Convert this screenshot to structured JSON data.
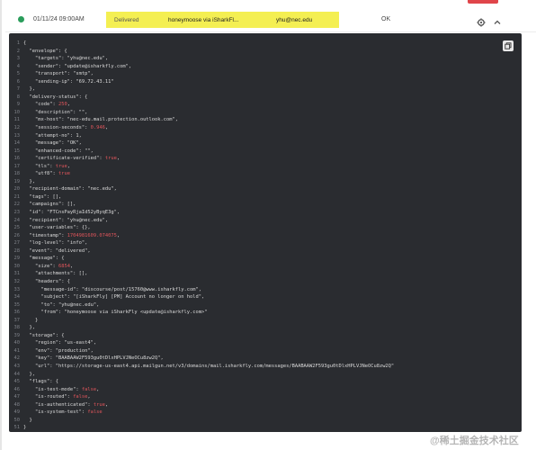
{
  "row": {
    "timestamp": "01/11/24 09:00AM",
    "event": "Delivered",
    "subject": "honeymoose via iSharkFl...",
    "recipient": "yhu@nec.edu",
    "status": "OK",
    "gear_icon": "gear-icon",
    "chevron_icon": "chevron-up-icon"
  },
  "code_lines": [
    {
      "n": "1",
      "t": "{"
    },
    {
      "n": "2",
      "t": "  \"envelope\": {"
    },
    {
      "n": "3",
      "t": "    \"targets\": \"yhu@nec.edu\","
    },
    {
      "n": "4",
      "t": "    \"sender\": \"update@isharkfly.com\","
    },
    {
      "n": "5",
      "t": "    \"transport\": \"smtp\","
    },
    {
      "n": "6",
      "t": "    \"sending-ip\": \"69.72.43.11\""
    },
    {
      "n": "7",
      "t": "  },"
    },
    {
      "n": "8",
      "t": "  \"delivery-status\": {"
    },
    {
      "n": "9",
      "t": "    \"code\": ",
      "v": "250",
      "vt": "num",
      "s": ","
    },
    {
      "n": "10",
      "t": "    \"description\": \"\","
    },
    {
      "n": "11",
      "t": "    \"mx-host\": \"nec-edu.mail.protection.outlook.com\","
    },
    {
      "n": "12",
      "t": "    \"session-seconds\": ",
      "v": "0.946",
      "vt": "num",
      "s": ","
    },
    {
      "n": "13",
      "t": "    \"attempt-no\": 1,"
    },
    {
      "n": "14",
      "t": "    \"message\": \"OK\","
    },
    {
      "n": "15",
      "t": "    \"enhanced-code\": \"\","
    },
    {
      "n": "16",
      "t": "    \"certificate-verified\": ",
      "v": "true",
      "vt": "bool",
      "s": ","
    },
    {
      "n": "17",
      "t": "    \"tls\": ",
      "v": "true",
      "vt": "bool",
      "s": ","
    },
    {
      "n": "18",
      "t": "    \"utf8\": ",
      "v": "true",
      "vt": "bool",
      "s": ""
    },
    {
      "n": "19",
      "t": "  },"
    },
    {
      "n": "20",
      "t": "  \"recipient-domain\": \"nec.edu\","
    },
    {
      "n": "21",
      "t": "  \"tags\": [],"
    },
    {
      "n": "22",
      "t": "  \"campaigns\": [],"
    },
    {
      "n": "23",
      "t": "  \"id\": \"FTCnsPayRjaId52yByqE3g\","
    },
    {
      "n": "24",
      "t": "  \"recipient\": \"yhu@nec.edu\","
    },
    {
      "n": "25",
      "t": "  \"user-variables\": {},"
    },
    {
      "n": "26",
      "t": "  \"timestamp\": ",
      "v": "1704981609.074075",
      "vt": "num",
      "s": ","
    },
    {
      "n": "27",
      "t": "  \"log-level\": \"info\","
    },
    {
      "n": "28",
      "t": "  \"event\": \"delivered\","
    },
    {
      "n": "29",
      "t": "  \"message\": {"
    },
    {
      "n": "30",
      "t": "    \"size\": ",
      "v": "6854",
      "vt": "num",
      "s": ","
    },
    {
      "n": "31",
      "t": "    \"attachments\": [],"
    },
    {
      "n": "32",
      "t": "    \"headers\": {"
    },
    {
      "n": "33",
      "t": "      \"message-id\": \"discourse/post/15760@www.isharkfly.com\","
    },
    {
      "n": "34",
      "t": "      \"subject\": \"[iSharkFly] [PM] Account no longer on hold\","
    },
    {
      "n": "35",
      "t": "      \"to\": \"yhu@nec.edu\","
    },
    {
      "n": "36",
      "t": "      \"from\": \"honeymoose via iSharkFly <update@isharkfly.com>\""
    },
    {
      "n": "37",
      "t": "    }"
    },
    {
      "n": "38",
      "t": "  },"
    },
    {
      "n": "39",
      "t": "  \"storage\": {"
    },
    {
      "n": "40",
      "t": "    \"region\": \"us-east4\","
    },
    {
      "n": "41",
      "t": "    \"env\": \"production\","
    },
    {
      "n": "42",
      "t": "    \"key\": \"BAABAAW2F593gu0tDlxHPLVJNeOCu8zw2Q\","
    },
    {
      "n": "43",
      "t": "    \"url\": \"https://storage-us-east4.api.mailgun.net/v3/domains/mail.isharkfly.com/messages/BAABAAW2F593gu0tDlxHPLVJNeOCu8zw2Q\""
    },
    {
      "n": "44",
      "t": "  },"
    },
    {
      "n": "45",
      "t": "  \"flags\": {"
    },
    {
      "n": "46",
      "t": "    \"is-test-mode\": ",
      "v": "false",
      "vt": "bool",
      "s": ","
    },
    {
      "n": "47",
      "t": "    \"is-routed\": ",
      "v": "false",
      "vt": "bool",
      "s": ","
    },
    {
      "n": "48",
      "t": "    \"is-authenticated\": ",
      "v": "true",
      "vt": "bool",
      "s": ","
    },
    {
      "n": "49",
      "t": "    \"is-system-test\": ",
      "v": "false",
      "vt": "bool",
      "s": ""
    },
    {
      "n": "50",
      "t": "  }"
    },
    {
      "n": "51",
      "t": "}"
    }
  ],
  "colors": {
    "highlight": "#f4ef52",
    "status_dot": "#2a9d5b",
    "panel_bg": "#2a2c30",
    "value_red": "#e0555b",
    "button_red": "#e0454a"
  },
  "watermark": "@稀土掘金技术社区"
}
